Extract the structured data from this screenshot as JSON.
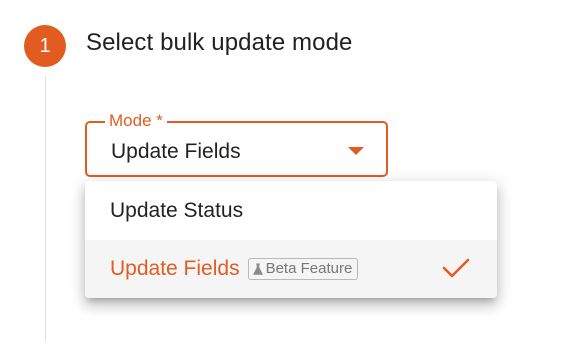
{
  "step": {
    "number": "1",
    "title": "Select bulk update mode"
  },
  "mode_select": {
    "label": "Mode *",
    "value": "Update Fields"
  },
  "menu": {
    "items": [
      {
        "label": "Update Status",
        "selected": false
      },
      {
        "label": "Update Fields",
        "selected": true,
        "badge": "Beta Feature"
      }
    ]
  },
  "colors": {
    "accent": "#e25c22",
    "text": "#222222",
    "selected_background": "#f5f5f5"
  }
}
